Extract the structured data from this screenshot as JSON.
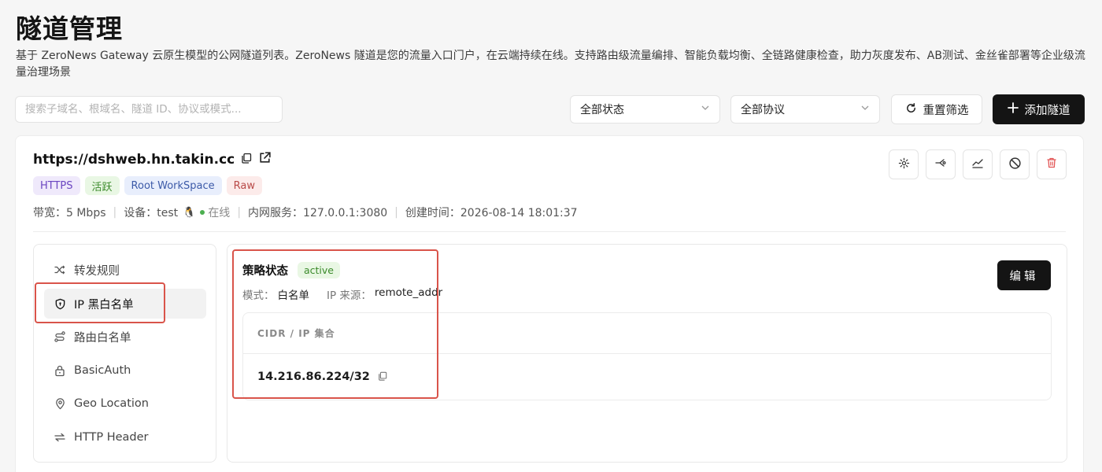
{
  "header": {
    "title": "隧道管理",
    "description": "基于 ZeroNews Gateway 云原生模型的公网隧道列表。ZeroNews 隧道是您的流量入口门户，在云端持续在线。支持路由级流量编排、智能负载均衡、全链路健康检查，助力灰度发布、AB测试、金丝雀部署等企业级流量治理场景"
  },
  "filters": {
    "search_placeholder": "搜索子域名、根域名、隧道 ID、协议或模式...",
    "status_selected": "全部状态",
    "protocol_selected": "全部协议",
    "reset_label": "重置筛选",
    "add_label": "添加隧道"
  },
  "tunnel": {
    "url": "https://dshweb.hn.takin.cc",
    "tags": {
      "protocol": "HTTPS",
      "state": "活跃",
      "workspace": "Root WorkSpace",
      "mode": "Raw"
    },
    "meta": {
      "bandwidth": "带宽：5 Mbps",
      "device": "设备：test",
      "online": "在线",
      "service": "内网服务：127.0.0.1:3080",
      "created": "创建时间：2026-08-14 18:01:37"
    }
  },
  "sidenav": {
    "items": [
      {
        "label": "转发规则",
        "icon": "shuffle-icon"
      },
      {
        "label": "IP 黑白名单",
        "icon": "shield-icon"
      },
      {
        "label": "路由白名单",
        "icon": "route-icon"
      },
      {
        "label": "BasicAuth",
        "icon": "lock-icon"
      },
      {
        "label": "Geo Location",
        "icon": "map-pin-icon"
      },
      {
        "label": "HTTP Header",
        "icon": "arrows-icon"
      }
    ],
    "active_index": 1
  },
  "policy": {
    "title": "策略状态",
    "status": "active",
    "mode_label": "模式：",
    "mode_value": "白名单",
    "source_label": "IP 来源：",
    "source_value": "remote_addr",
    "edit_label": "编辑",
    "table_header": "CIDR / IP 集合",
    "entries": [
      "14.216.86.224/32"
    ]
  },
  "colors": {
    "accent_dark": "#141414",
    "highlight": "#d9544a",
    "online": "#4caf50",
    "danger": "#e25555"
  }
}
